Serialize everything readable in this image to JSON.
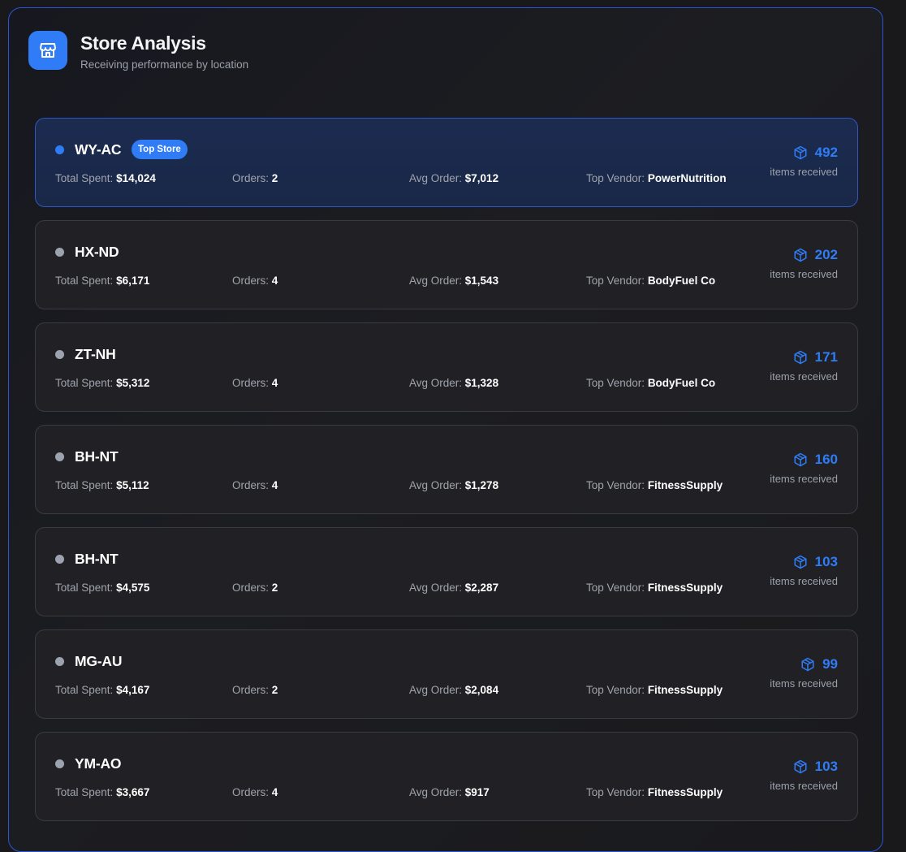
{
  "header": {
    "title": "Store Analysis",
    "subtitle": "Receiving performance by location",
    "icon": "store-icon"
  },
  "labels": {
    "total_spent": "Total Spent: ",
    "orders": "Orders: ",
    "avg_order": "Avg Order: ",
    "top_vendor": "Top Vendor: ",
    "items_received": "items received",
    "top_badge": "Top Store"
  },
  "colors": {
    "accent": "#2f7cf6",
    "panel_border": "#2b55d6",
    "muted_dot": "#9ca3af"
  },
  "stores": [
    {
      "name": "WY-AC",
      "top": true,
      "total_spent": "$14,024",
      "orders": "2",
      "avg_order": "$7,012",
      "top_vendor": "PowerNutrition",
      "items": "492"
    },
    {
      "name": "HX-ND",
      "top": false,
      "total_spent": "$6,171",
      "orders": "4",
      "avg_order": "$1,543",
      "top_vendor": "BodyFuel Co",
      "items": "202"
    },
    {
      "name": "ZT-NH",
      "top": false,
      "total_spent": "$5,312",
      "orders": "4",
      "avg_order": "$1,328",
      "top_vendor": "BodyFuel Co",
      "items": "171"
    },
    {
      "name": "BH-NT",
      "top": false,
      "total_spent": "$5,112",
      "orders": "4",
      "avg_order": "$1,278",
      "top_vendor": "FitnessSupply",
      "items": "160"
    },
    {
      "name": "BH-NT",
      "top": false,
      "total_spent": "$4,575",
      "orders": "2",
      "avg_order": "$2,287",
      "top_vendor": "FitnessSupply",
      "items": "103"
    },
    {
      "name": "MG-AU",
      "top": false,
      "total_spent": "$4,167",
      "orders": "2",
      "avg_order": "$2,084",
      "top_vendor": "FitnessSupply",
      "items": "99"
    },
    {
      "name": "YM-AO",
      "top": false,
      "total_spent": "$3,667",
      "orders": "4",
      "avg_order": "$917",
      "top_vendor": "FitnessSupply",
      "items": "103"
    }
  ]
}
